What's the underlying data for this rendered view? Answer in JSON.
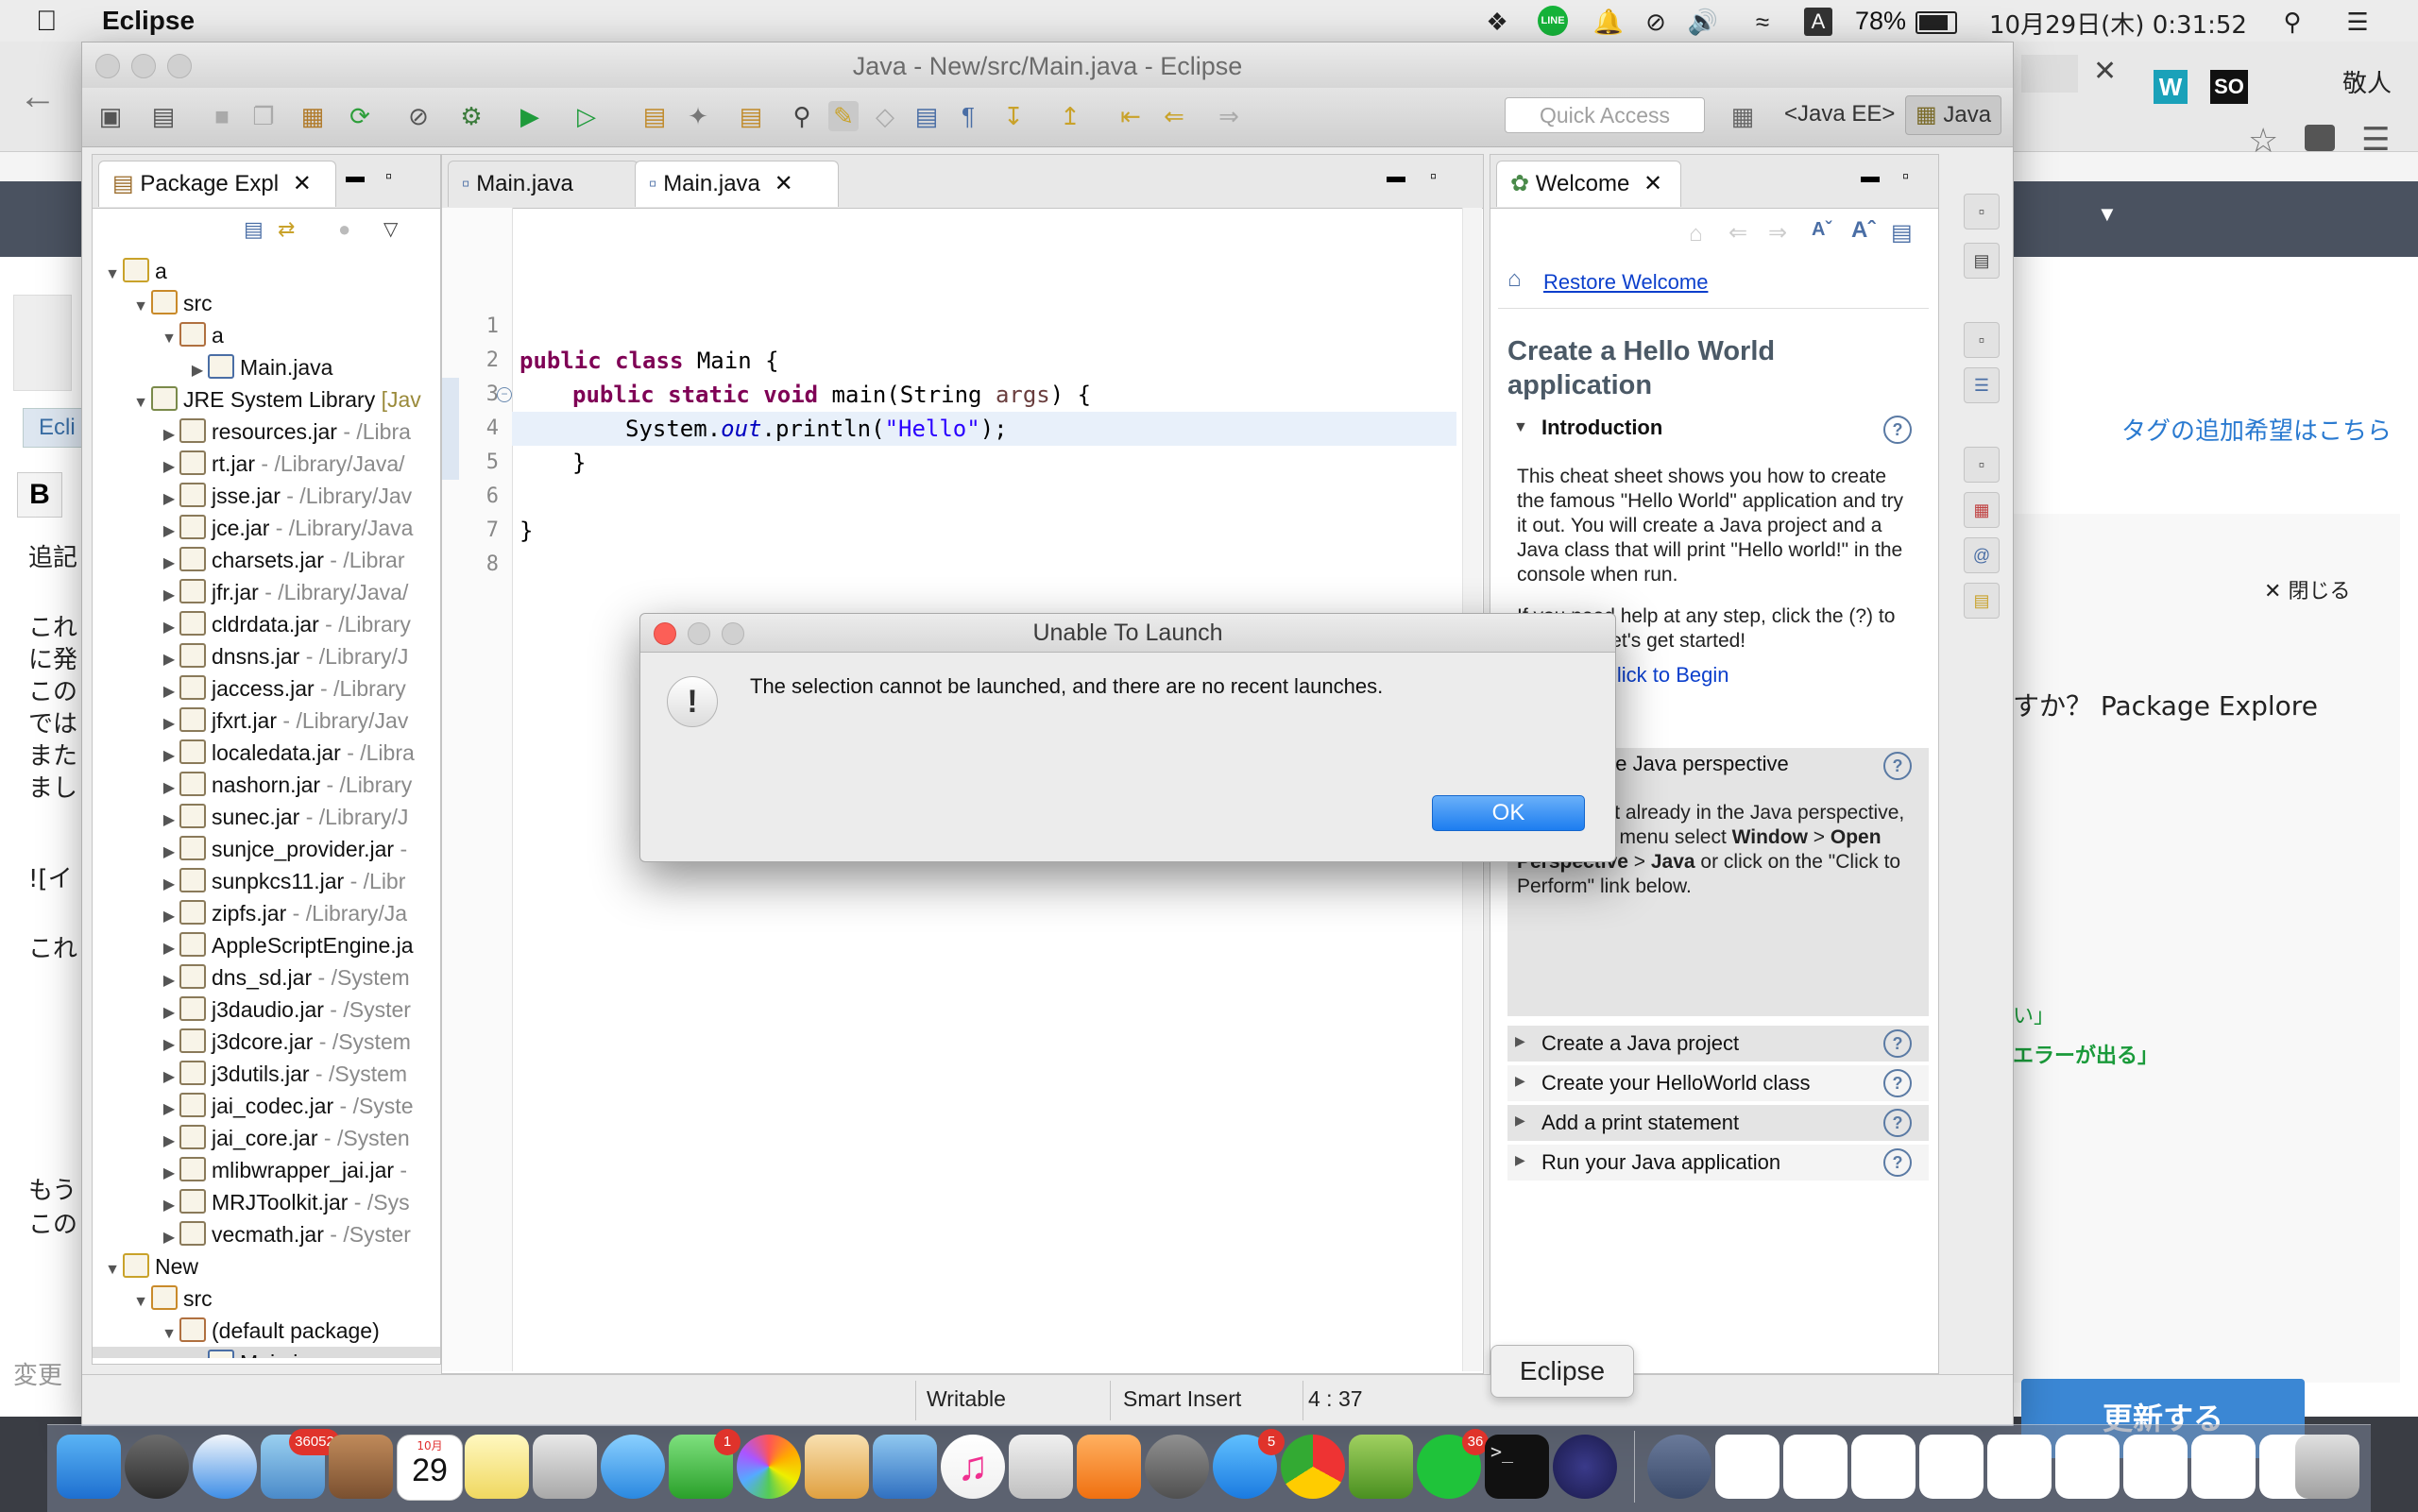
{
  "menubar": {
    "app_name": "Eclipse",
    "input_mode": "A",
    "battery": "78%",
    "clock": "10月29日(木) 0:31:52"
  },
  "browser": {
    "top_right_label": "敬人",
    "tag_request": "タグの追加希望はこちら",
    "close_label": "閉じる",
    "question_text": "すか？ Package Explore",
    "left_text_lines": [
      "追記",
      "これ",
      "に発",
      "この",
      "では",
      "また",
      "まし",
      "![イ",
      "これ",
      "もう",
      "この"
    ],
    "left_input_label": "Ecli",
    "left_change_label": "変更",
    "bold_label": "B",
    "green_line_1": "い」",
    "green_line_2": "エラーが出る」",
    "update_button": "更新する"
  },
  "eclipse": {
    "window_title": "Java - New/src/Main.java - Eclipse",
    "quick_access_placeholder": "Quick Access",
    "perspectives": [
      "<Java EE>",
      "Java"
    ],
    "package_explorer": {
      "tab_label": "Package Expl",
      "rows": [
        {
          "label": "a",
          "path": "",
          "type": "project",
          "depth": 0,
          "expanded": true
        },
        {
          "label": "src",
          "path": "",
          "type": "srcfolder",
          "depth": 1,
          "expanded": true
        },
        {
          "label": "a",
          "path": "",
          "type": "package",
          "depth": 2,
          "expanded": true
        },
        {
          "label": "Main.java",
          "path": "",
          "type": "java",
          "depth": 3,
          "expanded": false
        },
        {
          "label": "JRE System Library",
          "path": " [Jav",
          "type": "library",
          "depth": 1,
          "expanded": true
        },
        {
          "label": "resources.jar",
          "path": " - /Libra",
          "type": "jar",
          "depth": 2,
          "expanded": false
        },
        {
          "label": "rt.jar",
          "path": " - /Library/Java/",
          "type": "jar",
          "depth": 2,
          "expanded": false
        },
        {
          "label": "jsse.jar",
          "path": " - /Library/Jav",
          "type": "jar",
          "depth": 2,
          "expanded": false
        },
        {
          "label": "jce.jar",
          "path": " - /Library/Java",
          "type": "jar",
          "depth": 2,
          "expanded": false
        },
        {
          "label": "charsets.jar",
          "path": " - /Librar",
          "type": "jar",
          "depth": 2,
          "expanded": false
        },
        {
          "label": "jfr.jar",
          "path": " - /Library/Java/",
          "type": "jar",
          "depth": 2,
          "expanded": false
        },
        {
          "label": "cldrdata.jar",
          "path": " - /Library",
          "type": "jar",
          "depth": 2,
          "expanded": false
        },
        {
          "label": "dnsns.jar",
          "path": " - /Library/J",
          "type": "jar",
          "depth": 2,
          "expanded": false
        },
        {
          "label": "jaccess.jar",
          "path": " - /Library",
          "type": "jar",
          "depth": 2,
          "expanded": false
        },
        {
          "label": "jfxrt.jar",
          "path": " - /Library/Jav",
          "type": "jar",
          "depth": 2,
          "expanded": false
        },
        {
          "label": "localedata.jar",
          "path": " - /Libra",
          "type": "jar",
          "depth": 2,
          "expanded": false
        },
        {
          "label": "nashorn.jar",
          "path": " - /Library",
          "type": "jar",
          "depth": 2,
          "expanded": false
        },
        {
          "label": "sunec.jar",
          "path": " - /Library/J",
          "type": "jar",
          "depth": 2,
          "expanded": false
        },
        {
          "label": "sunjce_provider.jar",
          "path": " -",
          "type": "jar",
          "depth": 2,
          "expanded": false
        },
        {
          "label": "sunpkcs11.jar",
          "path": " - /Libr",
          "type": "jar",
          "depth": 2,
          "expanded": false
        },
        {
          "label": "zipfs.jar",
          "path": " - /Library/Ja",
          "type": "jar",
          "depth": 2,
          "expanded": false
        },
        {
          "label": "AppleScriptEngine.ja",
          "path": "",
          "type": "jar",
          "depth": 2,
          "expanded": false
        },
        {
          "label": "dns_sd.jar",
          "path": " - /System",
          "type": "jar",
          "depth": 2,
          "expanded": false
        },
        {
          "label": "j3daudio.jar",
          "path": " - /Syster",
          "type": "jar",
          "depth": 2,
          "expanded": false
        },
        {
          "label": "j3dcore.jar",
          "path": " - /System",
          "type": "jar",
          "depth": 2,
          "expanded": false
        },
        {
          "label": "j3dutils.jar",
          "path": " - /System",
          "type": "jar",
          "depth": 2,
          "expanded": false
        },
        {
          "label": "jai_codec.jar",
          "path": " - /Syste",
          "type": "jar",
          "depth": 2,
          "expanded": false
        },
        {
          "label": "jai_core.jar",
          "path": " - /Systen",
          "type": "jar",
          "depth": 2,
          "expanded": false
        },
        {
          "label": "mlibwrapper_jai.jar",
          "path": " -",
          "type": "jar",
          "depth": 2,
          "expanded": false
        },
        {
          "label": "MRJToolkit.jar",
          "path": " - /Sys",
          "type": "jar",
          "depth": 2,
          "expanded": false
        },
        {
          "label": "vecmath.jar",
          "path": " - /Syster",
          "type": "jar",
          "depth": 2,
          "expanded": false
        },
        {
          "label": "New",
          "path": "",
          "type": "project",
          "depth": 0,
          "expanded": true
        },
        {
          "label": "src",
          "path": "",
          "type": "srcfolder",
          "depth": 1,
          "expanded": true
        },
        {
          "label": "(default package)",
          "path": "",
          "type": "package",
          "depth": 2,
          "expanded": true
        },
        {
          "label": "Main.java",
          "path": "",
          "type": "java",
          "depth": 3,
          "expanded": false
        }
      ]
    },
    "editor": {
      "tabs": [
        "Main.java",
        "Main.java"
      ],
      "line_numbers": [
        "1",
        "2",
        "3",
        "4",
        "5",
        "6",
        "7",
        "8"
      ],
      "code": {
        "l2_kw": "public class",
        "l2_rest": " Main {",
        "l3_kw": "public static void",
        "l3_rest": " main(String ",
        "l3_param": "args",
        "l3_end": ") {",
        "l4_a": "System.",
        "l4_b": "out",
        "l4_c": ".println(",
        "l4_str": "\"Hello\"",
        "l4_end": ");",
        "l5": "}",
        "l7": "}"
      }
    },
    "welcome": {
      "tab_label": "Welcome",
      "restore_link": "Restore Welcome",
      "heading": "Create a Hello World application",
      "intro_title": "Introduction",
      "intro_text_1": "This cheat sheet shows you how to create the famous \"Hello World\" application and try it out. You will create a Java project and a Java class that will print \"Hello world!\" in the console when run.",
      "intro_text_2": "If you need help at any step, click the (?) to the right. Let's get started!",
      "click_to_begin": "Click to Begin",
      "step1_title": "Open the Java perspective",
      "step1_text_a": "If you're not already in the Java perspective, in the main menu select ",
      "step1_bold_1": "Window",
      "step1_sep_1": " > ",
      "step1_bold_2": "Open Perspective",
      "step1_sep_2": " > ",
      "step1_bold_3": "Java",
      "step1_text_b": " or click on the \"Click to Perform\" link below.",
      "steps": [
        "Create a Java project",
        "Create your HelloWorld class",
        "Add a print statement",
        "Run your Java application"
      ]
    },
    "status": {
      "writable": "Writable",
      "insert_mode": "Smart Insert",
      "position": "4 : 37"
    }
  },
  "dialog": {
    "title": "Unable To Launch",
    "message": "The selection cannot be launched, and there are no recent launches.",
    "ok_label": "OK"
  },
  "dock": {
    "tooltip": "Eclipse",
    "badges": {
      "mail": "36052",
      "facetime": "1",
      "appstore": "5",
      "line": "36"
    },
    "calendar_month": "10月",
    "calendar_day": "29"
  },
  "colors": {
    "accent": "#1c7df0",
    "link": "#0b3fcc",
    "keyword": "#7f0055",
    "string": "#2a00ff"
  }
}
